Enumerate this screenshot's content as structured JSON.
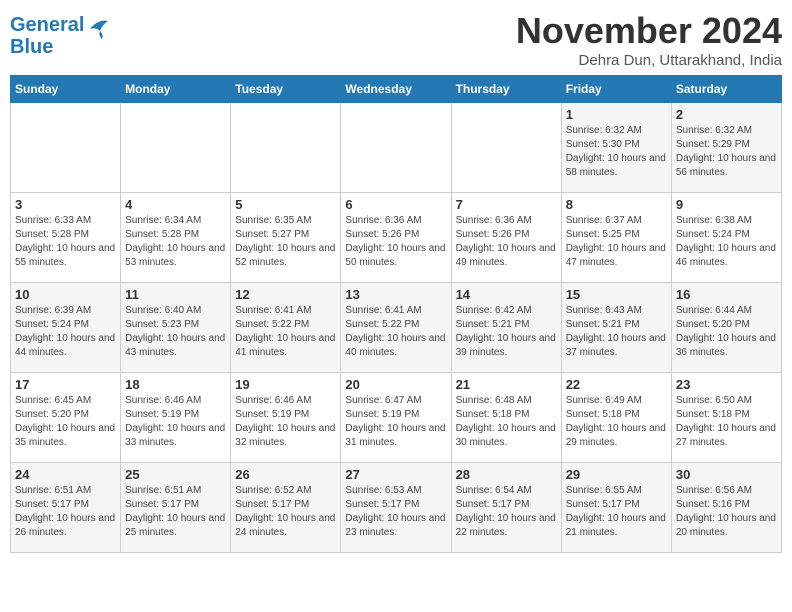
{
  "header": {
    "logo_line1": "General",
    "logo_line2": "Blue",
    "month": "November 2024",
    "subtitle": "Dehra Dun, Uttarakhand, India"
  },
  "days_of_week": [
    "Sunday",
    "Monday",
    "Tuesday",
    "Wednesday",
    "Thursday",
    "Friday",
    "Saturday"
  ],
  "weeks": [
    [
      {
        "day": "",
        "info": ""
      },
      {
        "day": "",
        "info": ""
      },
      {
        "day": "",
        "info": ""
      },
      {
        "day": "",
        "info": ""
      },
      {
        "day": "",
        "info": ""
      },
      {
        "day": "1",
        "info": "Sunrise: 6:32 AM\nSunset: 5:30 PM\nDaylight: 10 hours and 58 minutes."
      },
      {
        "day": "2",
        "info": "Sunrise: 6:32 AM\nSunset: 5:29 PM\nDaylight: 10 hours and 56 minutes."
      }
    ],
    [
      {
        "day": "3",
        "info": "Sunrise: 6:33 AM\nSunset: 5:28 PM\nDaylight: 10 hours and 55 minutes."
      },
      {
        "day": "4",
        "info": "Sunrise: 6:34 AM\nSunset: 5:28 PM\nDaylight: 10 hours and 53 minutes."
      },
      {
        "day": "5",
        "info": "Sunrise: 6:35 AM\nSunset: 5:27 PM\nDaylight: 10 hours and 52 minutes."
      },
      {
        "day": "6",
        "info": "Sunrise: 6:36 AM\nSunset: 5:26 PM\nDaylight: 10 hours and 50 minutes."
      },
      {
        "day": "7",
        "info": "Sunrise: 6:36 AM\nSunset: 5:26 PM\nDaylight: 10 hours and 49 minutes."
      },
      {
        "day": "8",
        "info": "Sunrise: 6:37 AM\nSunset: 5:25 PM\nDaylight: 10 hours and 47 minutes."
      },
      {
        "day": "9",
        "info": "Sunrise: 6:38 AM\nSunset: 5:24 PM\nDaylight: 10 hours and 46 minutes."
      }
    ],
    [
      {
        "day": "10",
        "info": "Sunrise: 6:39 AM\nSunset: 5:24 PM\nDaylight: 10 hours and 44 minutes."
      },
      {
        "day": "11",
        "info": "Sunrise: 6:40 AM\nSunset: 5:23 PM\nDaylight: 10 hours and 43 minutes."
      },
      {
        "day": "12",
        "info": "Sunrise: 6:41 AM\nSunset: 5:22 PM\nDaylight: 10 hours and 41 minutes."
      },
      {
        "day": "13",
        "info": "Sunrise: 6:41 AM\nSunset: 5:22 PM\nDaylight: 10 hours and 40 minutes."
      },
      {
        "day": "14",
        "info": "Sunrise: 6:42 AM\nSunset: 5:21 PM\nDaylight: 10 hours and 39 minutes."
      },
      {
        "day": "15",
        "info": "Sunrise: 6:43 AM\nSunset: 5:21 PM\nDaylight: 10 hours and 37 minutes."
      },
      {
        "day": "16",
        "info": "Sunrise: 6:44 AM\nSunset: 5:20 PM\nDaylight: 10 hours and 36 minutes."
      }
    ],
    [
      {
        "day": "17",
        "info": "Sunrise: 6:45 AM\nSunset: 5:20 PM\nDaylight: 10 hours and 35 minutes."
      },
      {
        "day": "18",
        "info": "Sunrise: 6:46 AM\nSunset: 5:19 PM\nDaylight: 10 hours and 33 minutes."
      },
      {
        "day": "19",
        "info": "Sunrise: 6:46 AM\nSunset: 5:19 PM\nDaylight: 10 hours and 32 minutes."
      },
      {
        "day": "20",
        "info": "Sunrise: 6:47 AM\nSunset: 5:19 PM\nDaylight: 10 hours and 31 minutes."
      },
      {
        "day": "21",
        "info": "Sunrise: 6:48 AM\nSunset: 5:18 PM\nDaylight: 10 hours and 30 minutes."
      },
      {
        "day": "22",
        "info": "Sunrise: 6:49 AM\nSunset: 5:18 PM\nDaylight: 10 hours and 29 minutes."
      },
      {
        "day": "23",
        "info": "Sunrise: 6:50 AM\nSunset: 5:18 PM\nDaylight: 10 hours and 27 minutes."
      }
    ],
    [
      {
        "day": "24",
        "info": "Sunrise: 6:51 AM\nSunset: 5:17 PM\nDaylight: 10 hours and 26 minutes."
      },
      {
        "day": "25",
        "info": "Sunrise: 6:51 AM\nSunset: 5:17 PM\nDaylight: 10 hours and 25 minutes."
      },
      {
        "day": "26",
        "info": "Sunrise: 6:52 AM\nSunset: 5:17 PM\nDaylight: 10 hours and 24 minutes."
      },
      {
        "day": "27",
        "info": "Sunrise: 6:53 AM\nSunset: 5:17 PM\nDaylight: 10 hours and 23 minutes."
      },
      {
        "day": "28",
        "info": "Sunrise: 6:54 AM\nSunset: 5:17 PM\nDaylight: 10 hours and 22 minutes."
      },
      {
        "day": "29",
        "info": "Sunrise: 6:55 AM\nSunset: 5:17 PM\nDaylight: 10 hours and 21 minutes."
      },
      {
        "day": "30",
        "info": "Sunrise: 6:56 AM\nSunset: 5:16 PM\nDaylight: 10 hours and 20 minutes."
      }
    ]
  ]
}
